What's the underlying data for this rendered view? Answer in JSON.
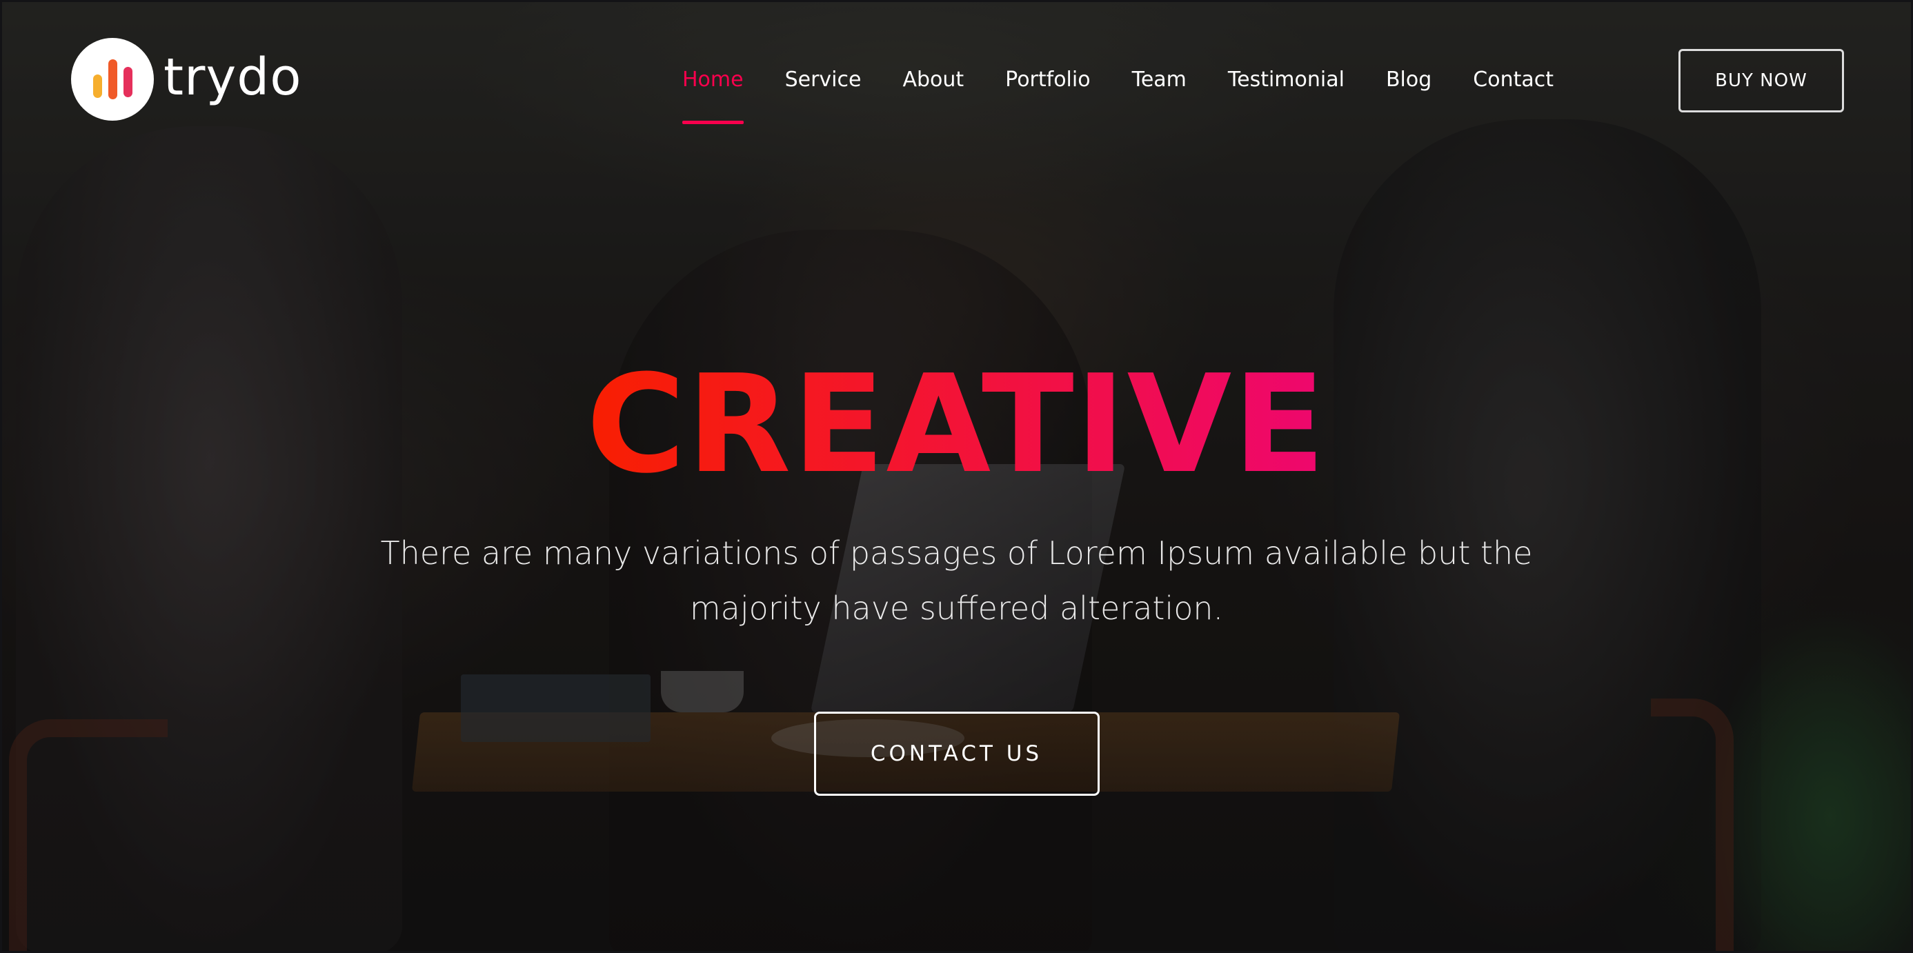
{
  "brand": {
    "name": "trydo",
    "logo_colors": [
      "#f6ae2d",
      "#f05a28",
      "#e5305b"
    ]
  },
  "nav": {
    "items": [
      {
        "label": "Home",
        "active": true
      },
      {
        "label": "Service",
        "active": false
      },
      {
        "label": "About",
        "active": false
      },
      {
        "label": "Portfolio",
        "active": false
      },
      {
        "label": "Team",
        "active": false
      },
      {
        "label": "Testimonial",
        "active": false
      },
      {
        "label": "Blog",
        "active": false
      },
      {
        "label": "Contact",
        "active": false
      }
    ],
    "buy_label": "BUY NOW"
  },
  "hero": {
    "title": "CREATIVE",
    "description": "There are many variations of passages of Lorem Ipsum available but the majority have suffered alteration.",
    "cta_label": "CONTACT US"
  },
  "colors": {
    "accent": "#f9004d",
    "title_gradient_start": "#f81f01",
    "title_gradient_end": "#ee076e"
  }
}
